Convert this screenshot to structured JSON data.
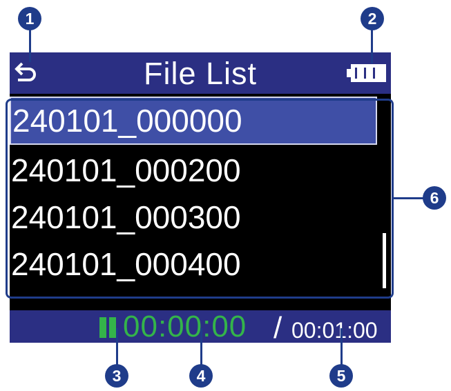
{
  "header": {
    "title": "File List",
    "back_icon": "back-arrow-icon",
    "battery_icon": "battery-icon"
  },
  "files": [
    {
      "name": "240101_000000",
      "selected": true
    },
    {
      "name": "240101_000200",
      "selected": false
    },
    {
      "name": "240101_000300",
      "selected": false
    },
    {
      "name": "240101_000400",
      "selected": false
    }
  ],
  "status": {
    "play_state_icon": "pause-icon",
    "elapsed": "00:00:00",
    "separator": "/",
    "total": "00:01:00"
  },
  "callouts": [
    "1",
    "2",
    "3",
    "4",
    "5",
    "6"
  ],
  "colors": {
    "bar_bg": "#2b2f83",
    "selected_row": "#3f4fa6",
    "elapsed_green": "#34b44a",
    "callout": "#1f3c8a"
  }
}
